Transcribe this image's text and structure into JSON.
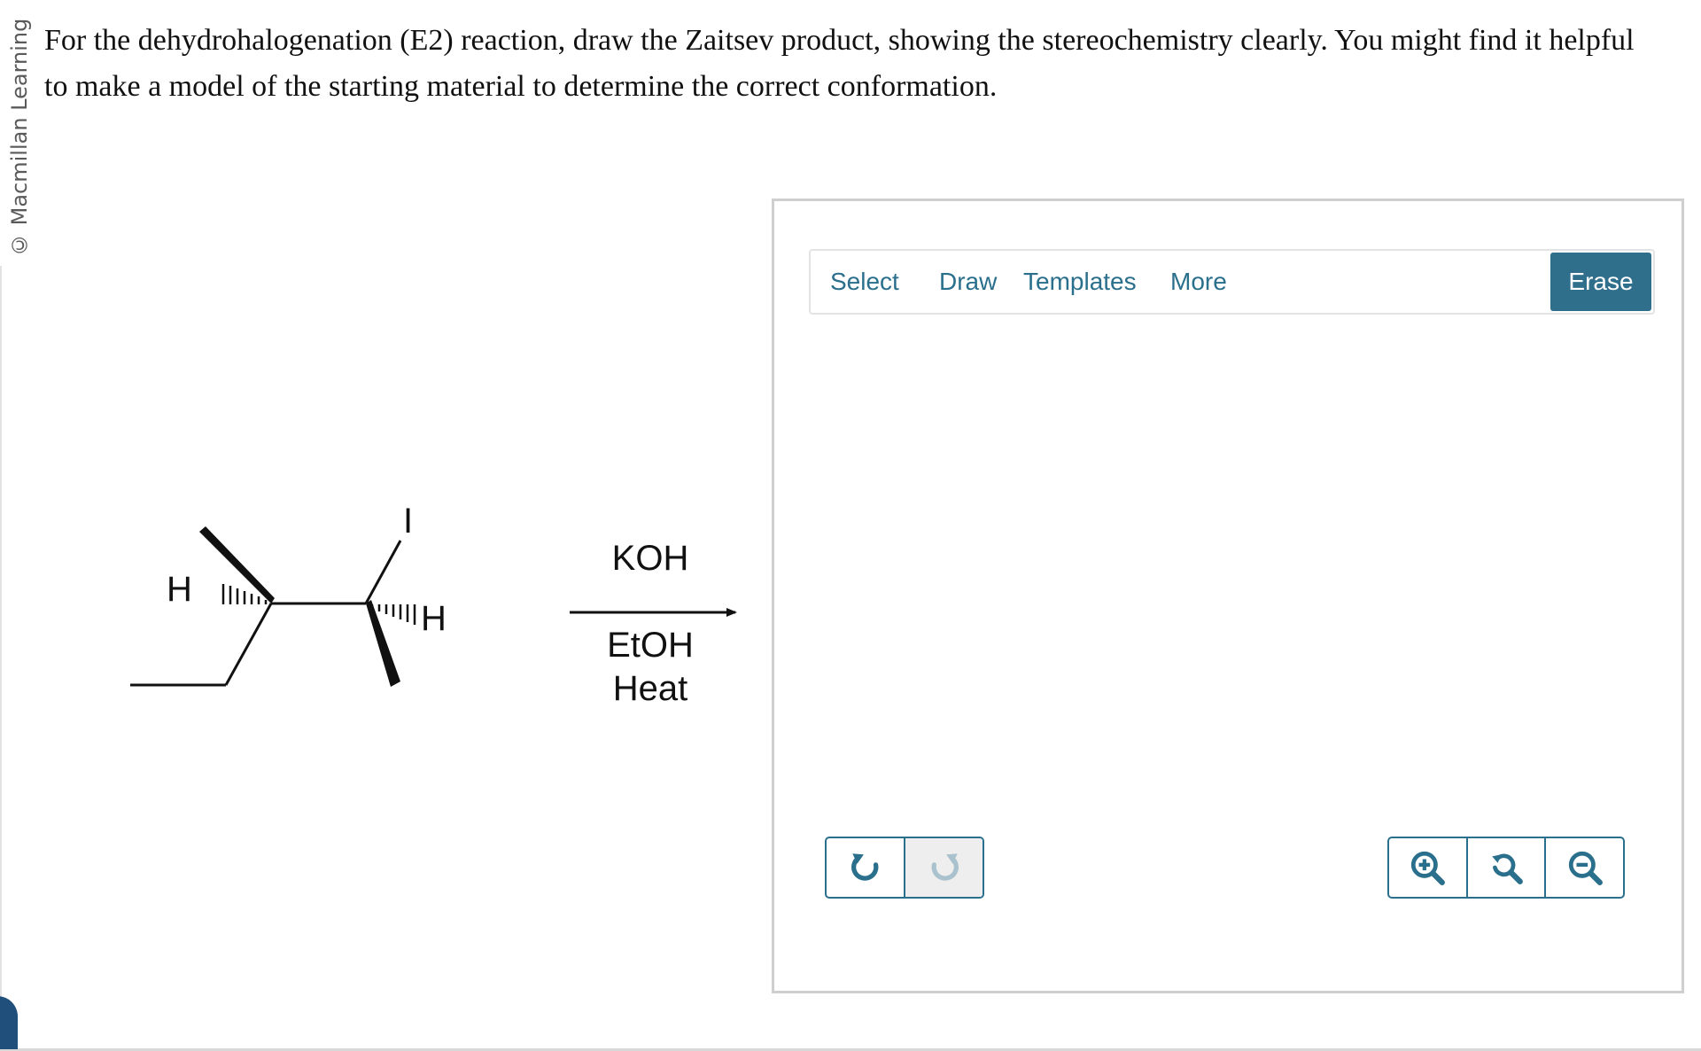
{
  "copyright": "© Macmillan Learning",
  "question": {
    "text": "For the dehydrohalogenation (E2) reaction, draw the Zaitsev product, showing the stereochemistry clearly. You might find it helpful to make a model of the starting material to determine the correct conformation."
  },
  "reaction": {
    "molecule_labels": {
      "h_left": "H",
      "iodine": "I",
      "h_right": "H"
    },
    "reagents": {
      "above_arrow": "KOH",
      "below_arrow_1": "EtOH",
      "below_arrow_2": "Heat"
    }
  },
  "editor": {
    "toolbar": {
      "select_label": "Select",
      "draw_label": "Draw",
      "templates_label": "Templates",
      "more_label": "More",
      "erase_label": "Erase"
    },
    "icons": {
      "undo": "undo-icon",
      "redo": "redo-icon",
      "zoom_in": "zoom-in-icon",
      "zoom_reset": "zoom-reset-icon",
      "zoom_out": "zoom-out-icon"
    },
    "colors": {
      "accent": "#2a6f8c",
      "erase_bg": "#2f6f8c",
      "disabled_bg": "#eeeeee"
    }
  }
}
